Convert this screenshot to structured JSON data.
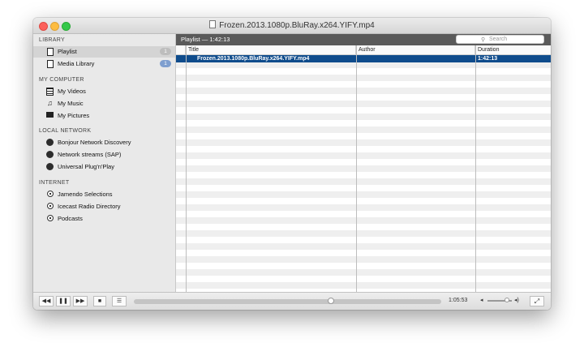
{
  "window": {
    "title": "Frozen.2013.1080p.BluRay.x264.YIFY.mp4"
  },
  "sidebar": {
    "library": {
      "heading": "LIBRARY",
      "items": [
        {
          "label": "Playlist",
          "badge": "1",
          "icon": "playlist-icon",
          "selected": true
        },
        {
          "label": "Media Library",
          "badge": "1",
          "icon": "media-library-icon",
          "selected": false
        }
      ]
    },
    "computer": {
      "heading": "MY COMPUTER",
      "items": [
        {
          "label": "My Videos",
          "icon": "film-icon"
        },
        {
          "label": "My Music",
          "icon": "music-note-icon"
        },
        {
          "label": "My Pictures",
          "icon": "picture-icon"
        }
      ]
    },
    "network": {
      "heading": "LOCAL NETWORK",
      "items": [
        {
          "label": "Bonjour Network Discovery",
          "icon": "network-icon"
        },
        {
          "label": "Network streams (SAP)",
          "icon": "network-icon"
        },
        {
          "label": "Universal Plug'n'Play",
          "icon": "network-icon"
        }
      ]
    },
    "internet": {
      "heading": "INTERNET",
      "items": [
        {
          "label": "Jamendo Selections",
          "icon": "podcast-icon"
        },
        {
          "label": "Icecast Radio Directory",
          "icon": "podcast-icon"
        },
        {
          "label": "Podcasts",
          "icon": "podcast-icon"
        }
      ]
    }
  },
  "playlist": {
    "header": "Playlist — 1:42:13",
    "search_placeholder": "Search",
    "columns": {
      "title": "Title",
      "author": "Author",
      "duration": "Duration"
    },
    "rows": [
      {
        "title": "Frozen.2013.1080p.BluRay.x264.YIFY.mp4",
        "author": "",
        "duration": "1:42:13",
        "selected": true
      }
    ]
  },
  "controls": {
    "rewind": "◀◀",
    "pause": "❚❚",
    "forward": "▶▶",
    "stop": "■",
    "playlist_toggle": "☰",
    "time": "1:05:53",
    "progress_fraction": 0.64,
    "volume_fraction": 0.8,
    "fullscreen": "⤢"
  },
  "colors": {
    "selection": "#0f4c8c",
    "header_bar": "#5a5a5a"
  }
}
